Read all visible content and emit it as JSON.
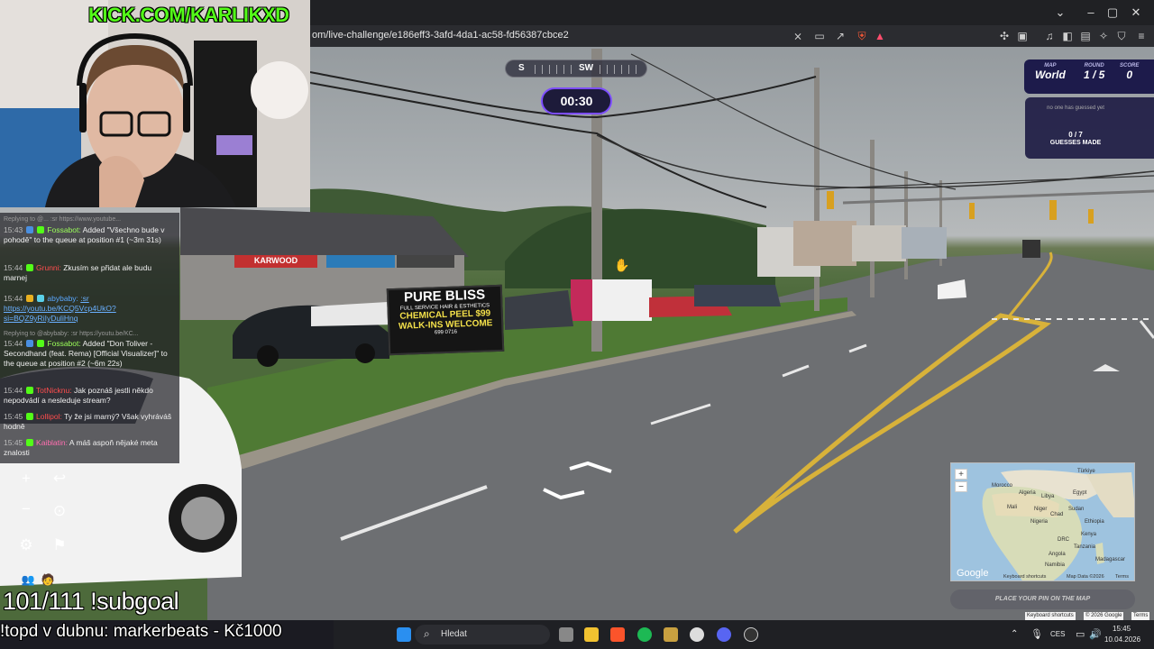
{
  "overlay": {
    "channel": "KICK.COM/KARLIKXD",
    "subgoal": "101/111 !subgoal",
    "topd": "!topd v dubnu: markerbeats - Kč1000"
  },
  "browser": {
    "url": "om/live-challenge/e186eff3-3afd-4da1-ac58-fd56387cbce2"
  },
  "game": {
    "compass": {
      "left": "S",
      "right": "SW"
    },
    "timer": "00:30",
    "map_label": "MAP",
    "map_value": "World",
    "round_label": "ROUND",
    "round_value": "1 / 5",
    "score_label": "SCORE",
    "score_value": "0",
    "guess_note": "no one has guessed yet",
    "guess_count": "0 / 7",
    "guess_label": "GUESSES MADE",
    "place_pin": "PLACE YOUR PIN ON THE MAP"
  },
  "minimap": {
    "labels": [
      "Türkiye",
      "Algeria",
      "Libya",
      "Egypt",
      "Mali",
      "Niger",
      "Sudan",
      "Chad",
      "Nigeria",
      "Ethiopia",
      "Kenya",
      "DRC",
      "Tanzania",
      "Angola",
      "Namibia",
      "Madagascar",
      "Morocco"
    ],
    "google": "Google",
    "keyboard": "Keyboard shortcuts",
    "map_data": "Map Data ©2026",
    "terms": "Terms"
  },
  "attribution": {
    "shortcuts": "Keyboard shortcuts",
    "copyright": "© 2026 Google",
    "terms": "Terms"
  },
  "street_sign": {
    "line1": "PURE BLISS",
    "line2": "FULL SERVICE HAIR & ESTHETICS",
    "line3": "CHEMICAL PEEL $99",
    "line4": "WALK-INS WELCOME",
    "line5": "699 0716",
    "karwood": "KARWOOD"
  },
  "chat": [
    {
      "ts": "",
      "nick": "",
      "text": "Replying to @... :sr https://www.youtube..."
    },
    {
      "ts": "15:43",
      "nick": "Fossabot:",
      "text": "Added \"Všechno bude v pohodě\" to the queue at position #1 (~3m 31s)"
    },
    {
      "ts": "15:44",
      "nick": "Grunni:",
      "text": "Zkusím se přidat ale budu marnej"
    },
    {
      "ts": "15:44",
      "nick": "abybaby:",
      "text": ":sr https://youtu.be/KCQ5Vcp4UkO?si=BQZ9yRiIyDuliHnq"
    },
    {
      "ts": "",
      "nick": "",
      "text": "Replying to @abybaby: :sr https://youtu.be/KC..."
    },
    {
      "ts": "15:44",
      "nick": "Fossabot:",
      "text": "Added \"Don Toliver - Secondhand (feat. Rema) [Official Visualizer]\" to the queue at position #2 (~6m 22s)"
    },
    {
      "ts": "15:44",
      "nick": "TotNicknu:",
      "text": "Jak poznáš jestli někdo nepodvádí a nesleduje stream?"
    },
    {
      "ts": "15:45",
      "nick": "Lollipol:",
      "text": "Ty že jsi marný? Však vyhráváš hodně"
    },
    {
      "ts": "15:45",
      "nick": "Kaiblatin:",
      "text": "A máš aspoň nějaké meta znalosti"
    }
  ],
  "taskbar": {
    "search": "Hledat",
    "lang": "CES",
    "time": "15:45",
    "date": "10.04.2026"
  },
  "colors": {
    "kick_green": "#53fc18",
    "timer_border": "#7c4dff",
    "panel_bg": "#1d1b4b"
  }
}
